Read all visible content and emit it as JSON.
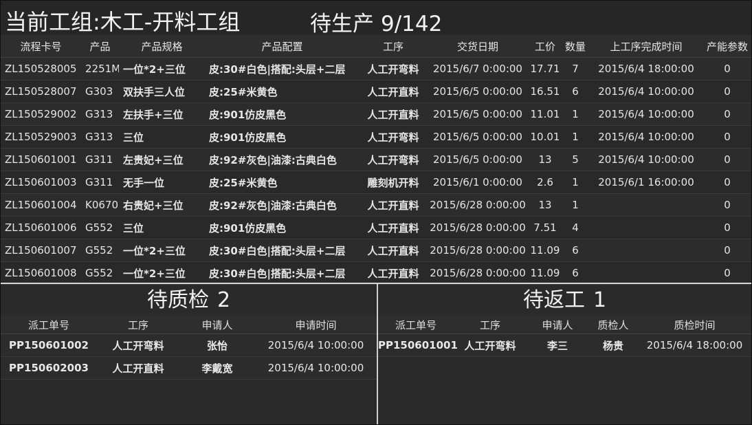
{
  "header": {
    "group_label": "当前工组:木工-开料工组",
    "pending_label": "待生产",
    "pending_count": "9/142"
  },
  "main_table": {
    "columns": [
      "流程卡号",
      "产品",
      "产品规格",
      "产品配置",
      "工序",
      "交货日期",
      "工价",
      "数量",
      "上工序完成时间",
      "产能参数"
    ],
    "rows": [
      [
        "ZL150528005",
        "2251M",
        "一位*2+三位",
        "皮:30#白色|搭配:头层+二层",
        "人工开弯料",
        "2015/6/7 0:00:00",
        "17.71",
        "7",
        "2015/6/4 18:00:00",
        "0"
      ],
      [
        "ZL150528007",
        "G303",
        "双扶手三人位",
        "皮:25#米黄色",
        "人工开直料",
        "2015/6/5 0:00:00",
        "16.51",
        "6",
        "2015/6/4 10:00:00",
        "0"
      ],
      [
        "ZL150529002",
        "G313",
        "左扶手+三位",
        "皮:901仿皮黑色",
        "人工开直料",
        "2015/6/5 0:00:00",
        "11.01",
        "1",
        "2015/6/4 10:00:00",
        "0"
      ],
      [
        "ZL150529003",
        "G313",
        "三位",
        "皮:901仿皮黑色",
        "人工开弯料",
        "2015/6/5 0:00:00",
        "10.01",
        "1",
        "2015/6/4 10:00:00",
        "0"
      ],
      [
        "ZL150601001",
        "G311",
        "左贵妃+三位",
        "皮:92#灰色|油漆:古典白色",
        "人工开弯料",
        "2015/6/5 0:00:00",
        "13",
        "5",
        "2015/6/4 10:00:00",
        "0"
      ],
      [
        "ZL150601003",
        "G311",
        "无手一位",
        "皮:25#米黄色",
        "雕刻机开料",
        "2015/6/1 0:00:00",
        "2.6",
        "1",
        "2015/6/1 16:00:00",
        "0"
      ],
      [
        "ZL150601004",
        "K0670",
        "右贵妃+三位",
        "皮:92#灰色|油漆:古典白色",
        "人工开直料",
        "2015/6/28 0:00:00",
        "13",
        "1",
        "",
        "0"
      ],
      [
        "ZL150601006",
        "G552",
        "三位",
        "皮:901仿皮黑色",
        "人工开直料",
        "2015/6/28 0:00:00",
        "7.51",
        "4",
        "",
        "0"
      ],
      [
        "ZL150601007",
        "G552",
        "一位*2+三位",
        "皮:30#白色|搭配:头层+二层",
        "人工开直料",
        "2015/6/28 0:00:00",
        "11.09",
        "6",
        "",
        "0"
      ],
      [
        "ZL150601008",
        "G552",
        "一位*2+三位",
        "皮:30#白色|搭配:头层+二层",
        "人工开直料",
        "2015/6/28 0:00:00",
        "11.09",
        "6",
        "",
        "0"
      ]
    ]
  },
  "qc_panel": {
    "title": "待质检",
    "count": "2",
    "columns": [
      "派工单号",
      "工序",
      "申请人",
      "申请时间"
    ],
    "rows": [
      [
        "PP150601002",
        "人工开弯料",
        "张怡",
        "2015/6/4 10:00:00"
      ],
      [
        "PP150602003",
        "人工开直料",
        "李戴宽",
        "2015/6/4 10:00:00"
      ]
    ]
  },
  "rework_panel": {
    "title": "待返工",
    "count": "1",
    "columns": [
      "派工单号",
      "工序",
      "申请人",
      "质检人",
      "质检时间"
    ],
    "rows": [
      [
        "PP150601001",
        "人工开弯料",
        "李三",
        "杨贵",
        "2015/6/4 18:00:00"
      ]
    ]
  }
}
